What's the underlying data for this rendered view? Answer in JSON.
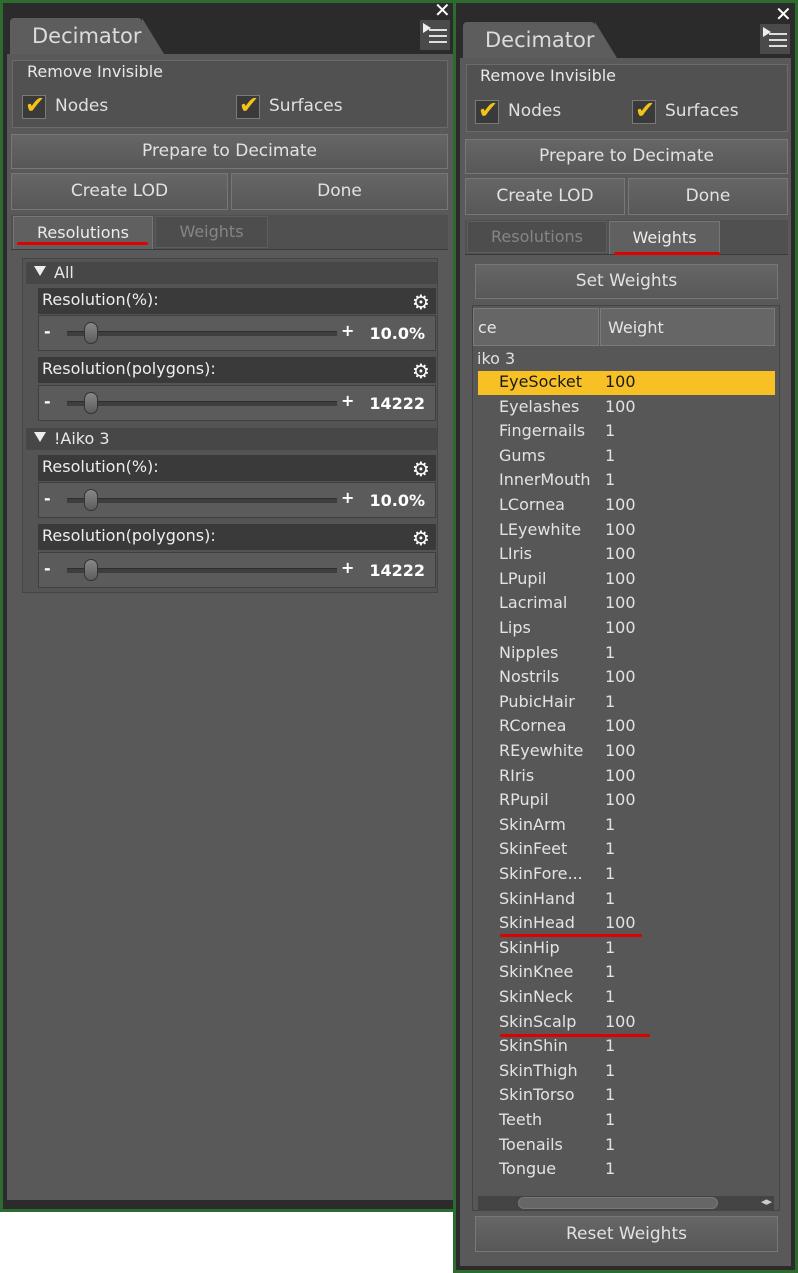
{
  "left_panel": {
    "title": "Decimator",
    "remove_invisible": {
      "label": "Remove Invisible",
      "nodes": "Nodes",
      "surfaces": "Surfaces"
    },
    "prepare_button": "Prepare to Decimate",
    "create_lod_button": "Create LOD",
    "done_button": "Done",
    "tabs": {
      "resolutions": "Resolutions",
      "weights": "Weights",
      "active": "Resolutions"
    },
    "groups": [
      {
        "name": "All",
        "params": [
          {
            "label": "Resolution(%):",
            "value": "10.0%"
          },
          {
            "label": "Resolution(polygons):",
            "value": "14222"
          }
        ]
      },
      {
        "name": "!Aiko 3",
        "params": [
          {
            "label": "Resolution(%):",
            "value": "10.0%"
          },
          {
            "label": "Resolution(polygons):",
            "value": "14222"
          }
        ]
      }
    ]
  },
  "right_panel": {
    "title": "Decimator",
    "remove_invisible": {
      "label": "Remove Invisible",
      "nodes": "Nodes",
      "surfaces": "Surfaces"
    },
    "prepare_button": "Prepare to Decimate",
    "create_lod_button": "Create LOD",
    "done_button": "Done",
    "tabs": {
      "resolutions": "Resolutions",
      "weights": "Weights",
      "active": "Weights"
    },
    "set_weights_button": "Set Weights",
    "columns": {
      "surface": "ce",
      "weight": "Weight"
    },
    "figure_label": "iko 3",
    "rows": [
      {
        "name": "EyeSocket",
        "weight": "100",
        "selected": true
      },
      {
        "name": "Eyelashes",
        "weight": "100"
      },
      {
        "name": "Fingernails",
        "weight": "1"
      },
      {
        "name": "Gums",
        "weight": "1"
      },
      {
        "name": "InnerMouth",
        "weight": "1"
      },
      {
        "name": "LCornea",
        "weight": "100"
      },
      {
        "name": "LEyewhite",
        "weight": "100"
      },
      {
        "name": "LIris",
        "weight": "100"
      },
      {
        "name": "LPupil",
        "weight": "100"
      },
      {
        "name": "Lacrimal",
        "weight": "100"
      },
      {
        "name": "Lips",
        "weight": "100"
      },
      {
        "name": "Nipples",
        "weight": "1"
      },
      {
        "name": "Nostrils",
        "weight": "100"
      },
      {
        "name": "PubicHair",
        "weight": "1"
      },
      {
        "name": "RCornea",
        "weight": "100"
      },
      {
        "name": "REyewhite",
        "weight": "100"
      },
      {
        "name": "RIris",
        "weight": "100"
      },
      {
        "name": "RPupil",
        "weight": "100"
      },
      {
        "name": "SkinArm",
        "weight": "1"
      },
      {
        "name": "SkinFeet",
        "weight": "1"
      },
      {
        "name": "SkinFore...",
        "weight": "1"
      },
      {
        "name": "SkinHand",
        "weight": "1"
      },
      {
        "name": "SkinHead",
        "weight": "100"
      },
      {
        "name": "SkinHip",
        "weight": "1"
      },
      {
        "name": "SkinKnee",
        "weight": "1"
      },
      {
        "name": "SkinNeck",
        "weight": "1"
      },
      {
        "name": "SkinScalp",
        "weight": "100"
      },
      {
        "name": "SkinShin",
        "weight": "1"
      },
      {
        "name": "SkinThigh",
        "weight": "1"
      },
      {
        "name": "SkinTorso",
        "weight": "1"
      },
      {
        "name": "Teeth",
        "weight": "1"
      },
      {
        "name": "Toenails",
        "weight": "1"
      },
      {
        "name": "Tongue",
        "weight": "1"
      }
    ],
    "reset_button": "Reset Weights"
  },
  "colors": {
    "highlight": "#f7c125",
    "annotation": "#e00000",
    "checkmark": "#f2c418",
    "frame": "#2e6b2e"
  }
}
